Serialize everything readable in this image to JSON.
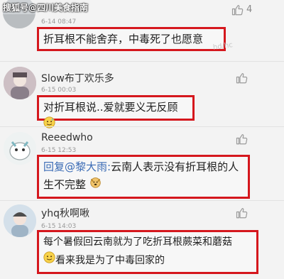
{
  "watermark": {
    "source": "搜狐号@四川美食指南",
    "faint": "hd/hc"
  },
  "comments": [
    {
      "username": "",
      "time": "6-14 08:47",
      "likes": "4",
      "text": "折耳根不能舍弃，中毒死了也愿意"
    },
    {
      "username": "Slow布丁欢乐多",
      "time": "6-15 00:03",
      "likes": "",
      "text": "对折耳根说..爱就要义无反顾",
      "emoji": "sweat-smile-emoji"
    },
    {
      "username": "Reeedwho",
      "time": "6-15 12:53",
      "likes": "",
      "reply_to": "回复@黎大雨:",
      "text_line1": "云南人表示没有折耳根的人",
      "text_line2": "生不完整",
      "emoji": "dog-face-emoji"
    },
    {
      "username": "yhq秋啊啾",
      "time": "6-15 14:03",
      "likes": "",
      "text_line1": "每个暑假回云南就为了吃折耳根蕨菜和蘑菇",
      "text_line2": "看来我是为了中毒回家的",
      "emoji": "smile-emoji"
    }
  ],
  "colors": {
    "highlight_border": "#d5171d",
    "mention": "#3a6bb5"
  }
}
